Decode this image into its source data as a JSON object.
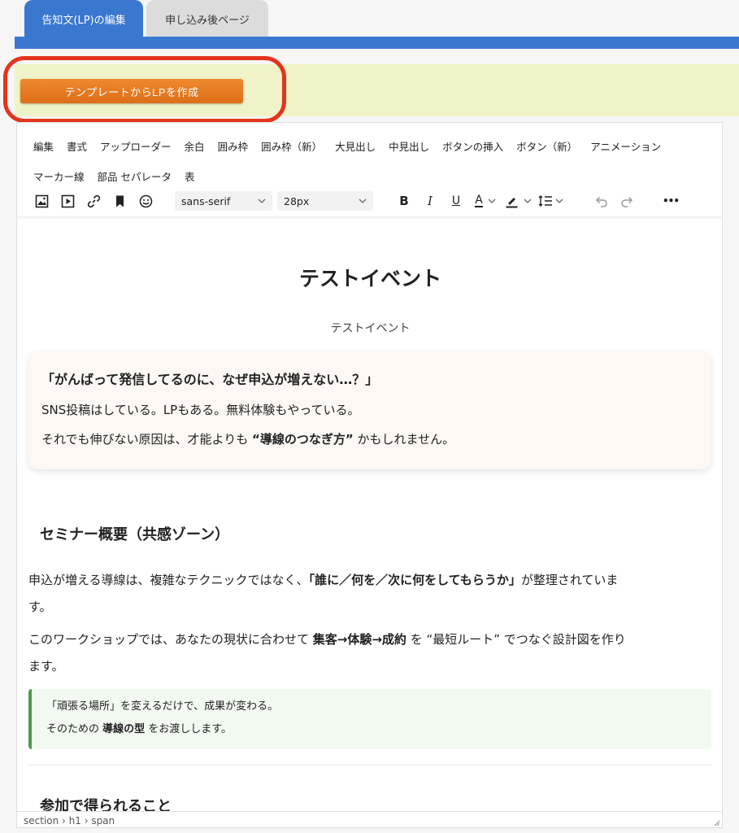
{
  "tabs": [
    {
      "label": "告知文(LP)の編集",
      "active": true
    },
    {
      "label": "申し込み後ページ",
      "active": false
    }
  ],
  "template_button": "テンプレートからLPを作成",
  "menubar": {
    "row1": [
      "編集",
      "書式",
      "アップローダー",
      "余白",
      "囲み枠",
      "囲み枠（新）",
      "大見出し",
      "中見出し",
      "ボタンの挿入",
      "ボタン（新）",
      "アニメーション"
    ],
    "row2": [
      "マーカー線",
      "部品 セパレータ",
      "表"
    ]
  },
  "toolbar": {
    "font_family": "sans-serif",
    "font_size": "28px",
    "bold": "B",
    "italic": "I",
    "underline": "U",
    "text_color": "A",
    "more": "•••"
  },
  "content": {
    "title": "テストイベント",
    "subtitle": "テストイベント",
    "card": {
      "heading": "「がんばって発信してるのに、なぜ申込が増えない…？」",
      "p1": "SNS投稿はしている。LPもある。無料体験もやっている。",
      "p2_a": "それでも伸びない原因は、才能よりも ",
      "p2_b": "“導線のつなぎ方”",
      "p2_c": " かもしれません。"
    },
    "section1_heading": "セミナー概要（共感ゾーン）",
    "para1_a": "申込が増える導線は、複雑なテクニックではなく、",
    "para1_b": "「誰に／何を／次に何をしてもらうか」",
    "para1_c": "が整理されていま",
    "para1_d": "す。",
    "para2_a": "このワークショップでは、あなたの現状に合わせて ",
    "para2_b": "集客→体験→成約",
    "para2_c": " を “最短ルート” でつなぐ設計図を作り",
    "para2_d": "ます。",
    "quote_line1": "「頑張る場所」を変えるだけで、成果が変わる。",
    "quote_line2_a": "そのための ",
    "quote_line2_b": "導線の型",
    "quote_line2_c": " をお渡しします。",
    "section2_heading": "参加で得られること"
  },
  "statusbar": {
    "path": "section › h1 › span"
  },
  "colors": {
    "accent": "#3a78d0",
    "orange": "#e57b22",
    "highlight": "#e5331c",
    "band": "#f0f3c7"
  }
}
